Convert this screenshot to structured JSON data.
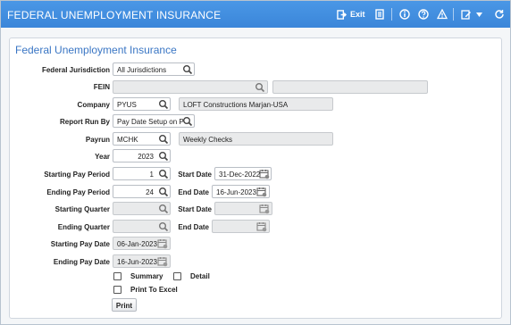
{
  "window": {
    "title": "FEDERAL UNEMPLOYMENT INSURANCE",
    "exit_label": "Exit"
  },
  "form": {
    "title": "Federal Unemployment Insurance",
    "federal_jurisdiction": {
      "label": "Federal Jurisdiction",
      "value": "All Jurisdictions"
    },
    "fein": {
      "label": "FEIN",
      "value": "",
      "description": ""
    },
    "company": {
      "label": "Company",
      "value": "PYUS",
      "description": "LOFT Constructions Marjan-USA"
    },
    "report_run_by": {
      "label": "Report Run By",
      "value": "Pay Date Setup on P"
    },
    "payrun": {
      "label": "Payrun",
      "value": "MCHK",
      "description": "Weekly Checks"
    },
    "year": {
      "label": "Year",
      "value": "2023"
    },
    "starting_pay_period": {
      "label": "Starting Pay Period",
      "value": "1"
    },
    "start_date_1": {
      "label": "Start Date",
      "value": "31-Dec-2022"
    },
    "ending_pay_period": {
      "label": "Ending Pay Period",
      "value": "24"
    },
    "end_date_1": {
      "label": "End Date",
      "value": "16-Jun-2023"
    },
    "starting_quarter": {
      "label": "Starting Quarter",
      "value": ""
    },
    "start_date_2": {
      "label": "Start Date",
      "value": ""
    },
    "ending_quarter": {
      "label": "Ending Quarter",
      "value": ""
    },
    "end_date_2": {
      "label": "End Date",
      "value": ""
    },
    "starting_pay_date": {
      "label": "Starting Pay Date",
      "value": "06-Jan-2023"
    },
    "ending_pay_date": {
      "label": "Ending Pay Date",
      "value": "16-Jun-2023"
    },
    "summary_label": "Summary",
    "detail_label": "Detail",
    "print_to_excel_label": "Print To Excel",
    "print_button": "Print"
  },
  "colors": {
    "titlebar": "#3b86d9",
    "form_title": "#3a76c4",
    "readonly_bg": "#e9eaeb"
  }
}
